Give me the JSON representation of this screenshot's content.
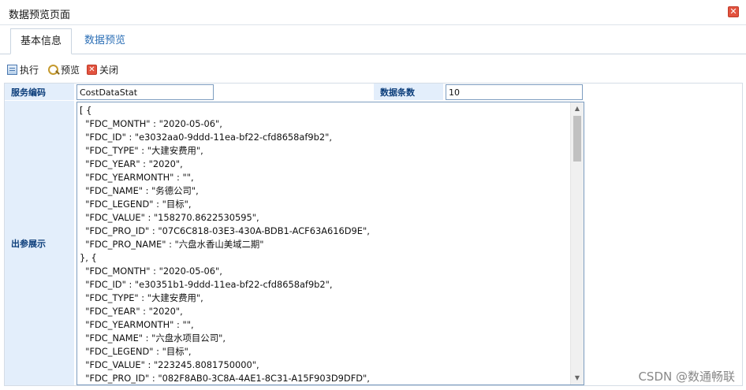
{
  "window": {
    "title": "数据预览页面"
  },
  "tabs": [
    {
      "label": "基本信息",
      "active": true
    },
    {
      "label": "数据预览",
      "active": false
    }
  ],
  "toolbar": {
    "exec_label": "执行",
    "preview_label": "预览",
    "close_label": "关闭"
  },
  "form": {
    "service_code_label": "服务编码",
    "service_code_value": "CostDataStat",
    "record_count_label": "数据条数",
    "record_count_value": "10",
    "output_label": "出参展示",
    "output_lines": [
      "[ {",
      "  \"FDC_MONTH\" : \"2020-05-06\",",
      "  \"FDC_ID\" : \"e3032aa0-9ddd-11ea-bf22-cfd8658af9b2\",",
      "  \"FDC_TYPE\" : \"大建安费用\",",
      "  \"FDC_YEAR\" : \"2020\",",
      "  \"FDC_YEARMONTH\" : \"\",",
      "  \"FDC_NAME\" : \"务德公司\",",
      "  \"FDC_LEGEND\" : \"目标\",",
      "  \"FDC_VALUE\" : \"158270.8622530595\",",
      "  \"FDC_PRO_ID\" : \"07C6C818-03E3-430A-BDB1-ACF63A616D9E\",",
      "  \"FDC_PRO_NAME\" : \"六盘水香山美域二期\"",
      "}, {",
      "  \"FDC_MONTH\" : \"2020-05-06\",",
      "  \"FDC_ID\" : \"e30351b1-9ddd-11ea-bf22-cfd8658af9b2\",",
      "  \"FDC_TYPE\" : \"大建安费用\",",
      "  \"FDC_YEAR\" : \"2020\",",
      "  \"FDC_YEARMONTH\" : \"\",",
      "  \"FDC_NAME\" : \"六盘水项目公司\",",
      "  \"FDC_LEGEND\" : \"目标\",",
      "  \"FDC_VALUE\" : \"223245.8081750000\",",
      "  \"FDC_PRO_ID\" : \"082F8AB0-3C8A-4AE1-8C31-A15F903D9DFD\","
    ]
  },
  "watermark": "CSDN @数通畅联",
  "colors": {
    "label_bg": "#e3eefb",
    "label_text": "#0b3d7a",
    "tab_inactive": "#2c6fb6",
    "close_red": "#e2533f"
  }
}
